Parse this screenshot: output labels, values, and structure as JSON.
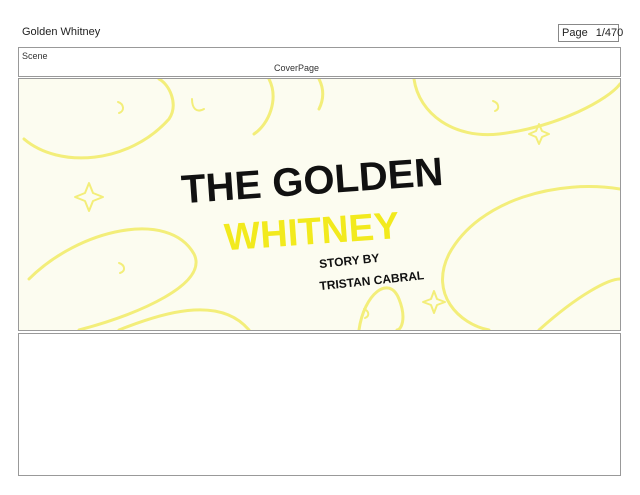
{
  "header": {
    "project_title": "Golden Whitney",
    "page_label": "Page",
    "page_number": "1/470"
  },
  "scene": {
    "label": "Scene",
    "name": "CoverPage"
  },
  "panels": [
    {
      "title_line_1": "THE GOLDEN",
      "title_line_2": "WHITNEY",
      "credit_line_1": "STORY BY",
      "credit_line_2": "TRISTAN CABRAL",
      "colors": {
        "background": "#fcfcf0",
        "swirls": "#f3ee7a",
        "title": "#111111",
        "accent": "#f2ea1d"
      }
    },
    {}
  ]
}
